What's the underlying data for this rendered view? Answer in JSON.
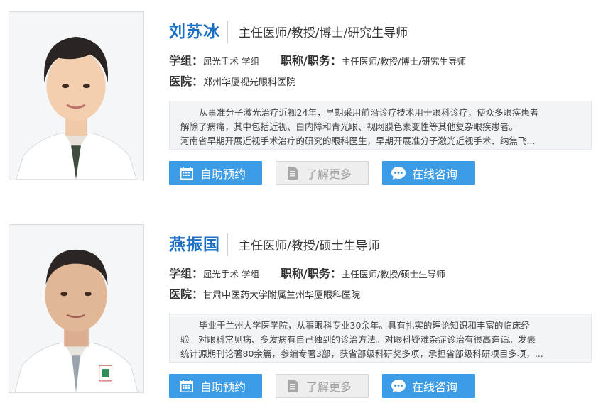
{
  "doctors": [
    {
      "name": "刘苏冰",
      "title": "主任医师/教授/博士/研究生导师",
      "group_label": "学组：",
      "group_value": "屈光手术 学组",
      "position_label": "职称/职务：",
      "position_value": "主任医师/教授/博士/研究生导师",
      "hospital_label": "医院：",
      "hospital_value": "郑州华厦视光眼科医院",
      "intro_lines": [
        "从事准分子激光治疗近视24年，早期采用前沿诊疗技术用于眼科诊疗，使众多眼疾患者",
        "解除了病痛，其中包括近视、白内障和青光眼、视网膜色素变性等其他复杂眼疾患者。",
        "河南省早期开展近视手术治疗的研究的眼科医生，早期开展准分子激光近视手术、纳焦飞..."
      ],
      "buttons": {
        "book": "自助预约",
        "more": "了解更多",
        "chat": "在线咨询"
      }
    },
    {
      "name": "燕振国",
      "title": "主任医师/教授/硕士生导师",
      "group_label": "学组：",
      "group_value": "屈光手术 学组",
      "position_label": "职称/职务：",
      "position_value": "主任医师/教授/硕士生导师",
      "hospital_label": "医院：",
      "hospital_value": "甘肃中医药大学附属兰州华厦眼科医院",
      "intro_lines": [
        "毕业于兰州大学医学院，从事眼科专业30余年。具有扎实的理论知识和丰富的临床经",
        "验。对眼科常见病、多发病有自己独到的诊治方法。对眼科疑难杂症诊治有很高造诣。发表",
        "统计源期刊论著80余篇，参编专著3部，获省部级科研奖多项，承担省部级科研项目多项，..."
      ],
      "buttons": {
        "book": "自助预约",
        "more": "了解更多",
        "chat": "在线咨询"
      }
    }
  ],
  "icons": {
    "book": "calendar-icon",
    "more": "document-icon",
    "chat": "chat-bubble-icon"
  },
  "colors": {
    "accent": "#3d9ce6",
    "name": "#1a6fc2",
    "intro_bg": "#f2f4f7"
  }
}
